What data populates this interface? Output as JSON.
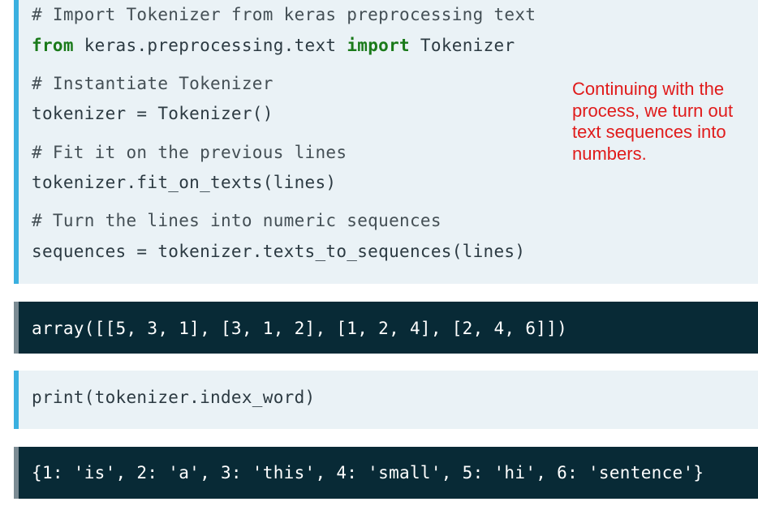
{
  "block1": {
    "comment1": "# Import Tokenizer from keras preprocessing text",
    "line1": {
      "kw_from": "from",
      "module": " keras.preprocessing.text ",
      "kw_import": "import",
      "name": " Tokenizer"
    },
    "comment2": "# Instantiate Tokenizer",
    "line2": "tokenizer = Tokenizer()",
    "comment3": "# Fit it on the previous lines",
    "line3": "tokenizer.fit_on_texts(lines)",
    "comment4": "# Turn the lines into numeric sequences",
    "line4": "sequences = tokenizer.texts_to_sequences(lines)"
  },
  "annotation": "Continuing with the process, we turn out text sequences into numbers.",
  "output1": "array([[5, 3, 1], [3, 1, 2], [1, 2, 4], [2, 4, 6]])",
  "block3": {
    "line": "print(tokenizer.index_word)"
  },
  "output2": "{1: 'is', 2: 'a', 3: 'this', 4: 'small', 5: 'hi', 6: 'sentence'}",
  "colors": {
    "code_bg": "#eaf2f6",
    "output_bg": "#082a36",
    "accent_bar": "#3ab0e0",
    "keyword": "#1a7a1a",
    "annotation": "#e01b1b"
  }
}
